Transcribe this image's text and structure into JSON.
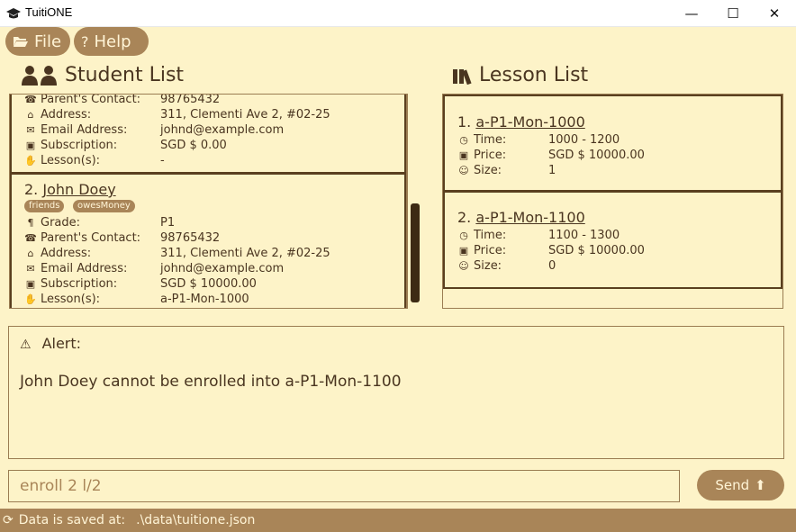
{
  "window": {
    "title": "TuitiONE",
    "controls": {
      "minimize": "—",
      "maximize": "☐",
      "close": "✕"
    }
  },
  "menu": {
    "file": {
      "label": "File",
      "icon": "folder-open-icon"
    },
    "help": {
      "label": "Help",
      "icon": "question-icon"
    }
  },
  "students": {
    "heading": "Student List",
    "icon": "students-icon",
    "cards": [
      {
        "index": "",
        "name": "",
        "tags": [],
        "fields": [
          {
            "label": "Parent's Contact:",
            "value": "98765432",
            "icon": "phone-icon"
          },
          {
            "label": "Address:",
            "value": "311, Clementi Ave 2, #02-25",
            "icon": "home-icon"
          },
          {
            "label": "Email Address:",
            "value": "johnd@example.com",
            "icon": "mail-icon"
          },
          {
            "label": "Subscription:",
            "value": "SGD $ 0.00",
            "icon": "money-icon"
          },
          {
            "label": "Lesson(s):",
            "value": "-",
            "icon": "lesson-icon"
          }
        ]
      },
      {
        "index": "2.",
        "name": "John Doey",
        "tags": [
          "friends",
          "owesMoney"
        ],
        "fields": [
          {
            "label": "Grade:",
            "value": "P1",
            "icon": "grade-icon"
          },
          {
            "label": "Parent's Contact:",
            "value": "98765432",
            "icon": "phone-icon"
          },
          {
            "label": "Address:",
            "value": "311, Clementi Ave 2, #02-25",
            "icon": "home-icon"
          },
          {
            "label": "Email Address:",
            "value": "johnd@example.com",
            "icon": "mail-icon"
          },
          {
            "label": "Subscription:",
            "value": "SGD $ 10000.00",
            "icon": "money-icon"
          },
          {
            "label": "Lesson(s):",
            "value": "a-P1-Mon-1000",
            "icon": "lesson-icon"
          }
        ]
      }
    ]
  },
  "lessons": {
    "heading": "Lesson List",
    "icon": "books-icon",
    "cards": [
      {
        "index": "1.",
        "code": "a-P1-Mon-1000",
        "fields": [
          {
            "label": "Time:",
            "value": "1000 - 1200",
            "icon": "clock-icon"
          },
          {
            "label": "Price:",
            "value": "SGD $ 10000.00",
            "icon": "money-icon"
          },
          {
            "label": "Size:",
            "value": "1",
            "icon": "smiley-icon"
          }
        ]
      },
      {
        "index": "2.",
        "code": "a-P1-Mon-1100",
        "fields": [
          {
            "label": "Time:",
            "value": "1100 - 1300",
            "icon": "clock-icon"
          },
          {
            "label": "Price:",
            "value": "SGD $ 10000.00",
            "icon": "money-icon"
          },
          {
            "label": "Size:",
            "value": "0",
            "icon": "smiley-icon"
          }
        ]
      }
    ]
  },
  "alert": {
    "heading": "Alert:",
    "message": "John Doey cannot be enrolled into a-P1-Mon-1100"
  },
  "command": {
    "value": "enroll 2 l/2",
    "send_label": "Send"
  },
  "status": {
    "label": "Data is saved at:",
    "path": ".\\data\\tuitione.json"
  }
}
